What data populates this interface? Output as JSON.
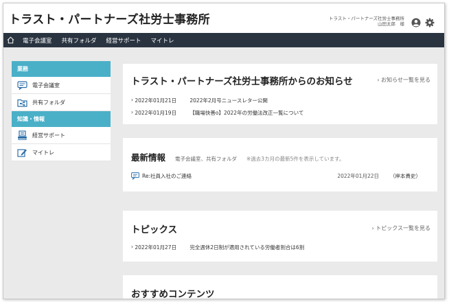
{
  "site": {
    "title": "トラスト・パートナーズ社労士事務所"
  },
  "user": {
    "office": "トラスト・パートナーズ社労士事務所",
    "name": "山田太郎　様"
  },
  "nav": {
    "items": [
      "電子会議室",
      "共有フォルダ",
      "経営サポート",
      "マイトレ"
    ]
  },
  "sidebar": {
    "sections": [
      {
        "heading": "業務",
        "items": [
          {
            "label": "電子会議室",
            "icon": "chat-icon"
          },
          {
            "label": "共有フォルダ",
            "icon": "shared-folder-icon"
          }
        ]
      },
      {
        "heading": "知識・情報",
        "items": [
          {
            "label": "経営サポート",
            "icon": "document-stack-icon"
          },
          {
            "label": "マイトレ",
            "icon": "pencil-notebook-icon"
          }
        ]
      }
    ]
  },
  "notices": {
    "title": "トラスト・パートナーズ社労士事務所からのお知らせ",
    "link": "お知らせ一覧を見る",
    "items": [
      {
        "date": "2022年01月21日",
        "text": "2022年2月号ニュースレター公開"
      },
      {
        "date": "2022年01月19日",
        "text": "【職場快善o】2022年の労働法改正一覧について"
      }
    ]
  },
  "latest": {
    "title": "最新情報",
    "subtitle": "電子会議室、共有フォルダ",
    "note": "※過去3カ月の最新5件を表示しています。",
    "items": [
      {
        "text": "Re:社員入社のご連絡",
        "date": "2022年01月22日",
        "author": "（岸本貴史）"
      }
    ]
  },
  "topics": {
    "title": "トピックス",
    "link": "トピックス一覧を見る",
    "items": [
      {
        "date": "2022年01月27日",
        "text": "完全週休2日制が適用されている労働者割合は6割"
      }
    ]
  },
  "recommended": {
    "title": "おすすめコンテンツ"
  },
  "colors": {
    "navbar": "#2a3441",
    "accent": "#4ab0c8",
    "background": "#eaeaea"
  }
}
